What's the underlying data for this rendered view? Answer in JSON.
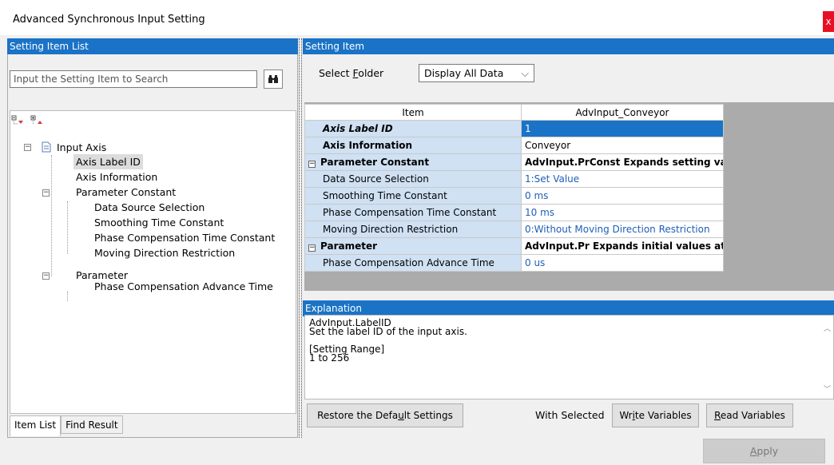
{
  "window": {
    "title": "Advanced Synchronous Input Setting",
    "close_label": "x"
  },
  "left_panel": {
    "header": "Setting Item List",
    "search_placeholder": "Input the Setting Item to Search",
    "tree": {
      "root": "Input Axis",
      "items": [
        {
          "label": "Axis Label ID",
          "level": 1,
          "selected": true
        },
        {
          "label": "Axis Information",
          "level": 1
        },
        {
          "label": "Parameter Constant",
          "level": 1,
          "expandable": true
        },
        {
          "label": "Data Source Selection",
          "level": 2
        },
        {
          "label": "Smoothing Time Constant",
          "level": 2
        },
        {
          "label": "Phase Compensation Time Constant",
          "level": 2
        },
        {
          "label": "Moving Direction Restriction",
          "level": 2
        },
        {
          "label": "Parameter",
          "level": 1,
          "expandable": true
        },
        {
          "label": "Phase Compensation Advance Time",
          "level": 2
        }
      ]
    },
    "tabs": [
      "Item List",
      "Find Result"
    ]
  },
  "right_panel": {
    "header": "Setting Item",
    "select_folder_label": "Select Folder",
    "select_folder_value": "Display All Data",
    "grid": {
      "col_item": "Item",
      "col_value": "AdvInput_Conveyor",
      "rows": [
        {
          "item": "Axis Label ID",
          "value": "1"
        },
        {
          "item": "Axis Information",
          "value": "Conveyor"
        },
        {
          "item": "Parameter Constant",
          "value": "AdvInput.PrConst Expands setting value"
        },
        {
          "item": "Data Source Selection",
          "value": "1:Set Value"
        },
        {
          "item": "Smoothing Time Constant",
          "value": "0 ms"
        },
        {
          "item": "Phase Compensation Time Constant",
          "value": "10 ms"
        },
        {
          "item": "Moving Direction Restriction",
          "value": "0:Without Moving Direction Restriction"
        },
        {
          "item": "Parameter",
          "value": "AdvInput.Pr Expands initial values at inp"
        },
        {
          "item": "Phase Compensation Advance Time",
          "value": "0 us"
        }
      ]
    },
    "explanation": {
      "header": "Explanation",
      "text": "AdvInput.LabelID\nSet the label ID of the input axis.\n\n[Setting Range]\n1 to 256"
    }
  },
  "buttons": {
    "restore": "Restore the Default Settings",
    "with_selected": "With Selected",
    "write": "Write Variables",
    "read": "Read Variables",
    "apply": "Apply"
  },
  "colors": {
    "header_blue": "#1a73c6",
    "grid_item_bg": "#cfe1f3",
    "value_link_blue": "#1f5fb8",
    "close_red": "#e81123"
  }
}
